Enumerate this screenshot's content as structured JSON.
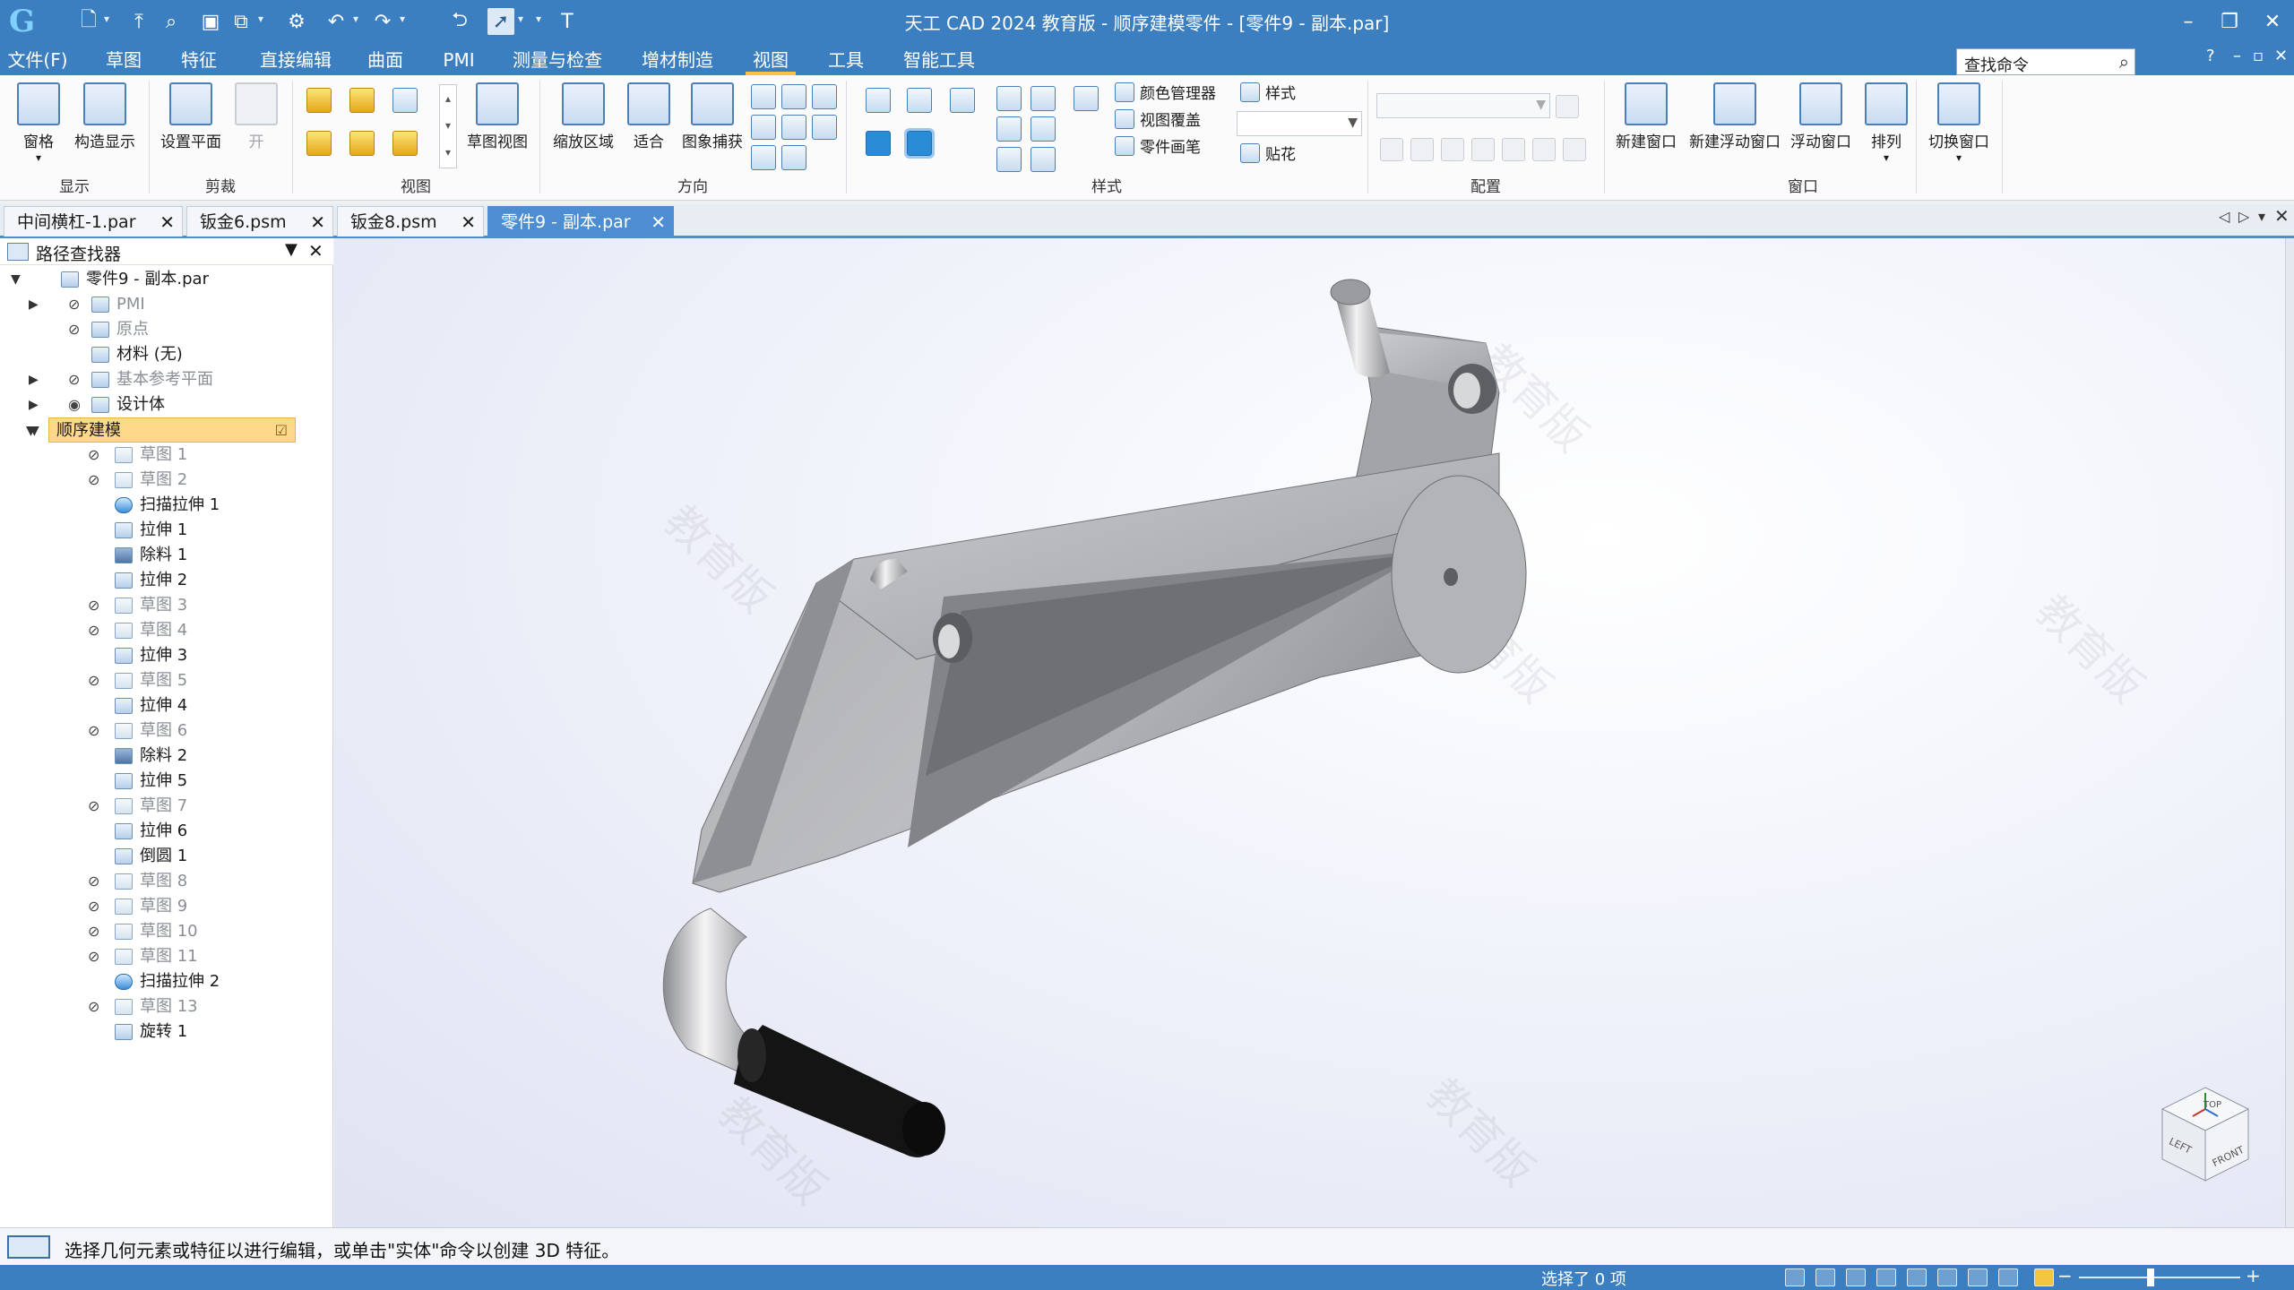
{
  "window": {
    "title": "天工 CAD 2024 教育版 - 顺序建模零件 - [零件9 - 副本.par]",
    "min_glyph": "–",
    "restore_glyph": "❐",
    "close_glyph": "✕"
  },
  "menu": {
    "items": [
      "文件(F)",
      "草图",
      "特征",
      "直接编辑",
      "曲面",
      "PMI",
      "测量与检查",
      "增材制造",
      "视图",
      "工具",
      "智能工具"
    ],
    "active": "视图",
    "search_value": "查找命令",
    "help": "?",
    "right_controls": [
      "–",
      "▫",
      "✕"
    ]
  },
  "ribbon": {
    "groups": {
      "display": "显示",
      "clip": "剪裁",
      "view": "视图",
      "orient": "方向",
      "style": "样式",
      "config": "配置",
      "window": "窗口"
    },
    "buttons": {
      "pane": "窗格",
      "construct_display": "构造显示",
      "set_plane": "设置平面",
      "open": "开",
      "sketch_view": "草图视图",
      "zoom_area": "缩放区域",
      "fit": "适合",
      "image_capture": "图象捕获",
      "color_manager": "颜色管理器",
      "view_overlay": "视图覆盖",
      "part_painter": "零件画笔",
      "style": "样式",
      "decal": "贴花",
      "new_window": "新建窗口",
      "new_float_window": "新建浮动窗口",
      "float_window": "浮动窗口",
      "arrange": "排列",
      "switch_window": "切换窗口"
    }
  },
  "tabs": [
    {
      "label": "中间横杠-1.par",
      "active": false
    },
    {
      "label": "钣金6.psm",
      "active": false
    },
    {
      "label": "钣金8.psm",
      "active": false
    },
    {
      "label": "零件9 - 副本.par",
      "active": true
    }
  ],
  "tab_close": "✕",
  "pathfinder": {
    "title": "路径查找器",
    "items": [
      {
        "label": "零件9 - 副本.par",
        "level": 0,
        "expand": "▼",
        "icon": "part",
        "eye": "",
        "dim": false
      },
      {
        "label": "PMI",
        "level": 1,
        "expand": "▶",
        "icon": "pmi",
        "eye": "⊘",
        "dim": true
      },
      {
        "label": "原点",
        "level": 1,
        "expand": "",
        "icon": "origin",
        "eye": "⊘",
        "dim": true
      },
      {
        "label": "材料 (无)",
        "level": 1,
        "expand": "",
        "icon": "material",
        "eye": "",
        "dim": false
      },
      {
        "label": "基本参考平面",
        "level": 1,
        "expand": "▶",
        "icon": "plane",
        "eye": "⊘",
        "dim": true
      },
      {
        "label": "设计体",
        "level": 1,
        "expand": "▶",
        "icon": "body",
        "eye": "◉",
        "dim": false
      },
      {
        "label": "顺序建模",
        "level": 1,
        "expand": "▼",
        "icon": "",
        "eye": "",
        "dim": false,
        "selected": true
      },
      {
        "label": "草图 1",
        "level": 2,
        "expand": "",
        "icon": "sketch",
        "eye": "⊘",
        "dim": true
      },
      {
        "label": "草图 2",
        "level": 2,
        "expand": "",
        "icon": "sketch",
        "eye": "⊘",
        "dim": true
      },
      {
        "label": "扫描拉伸 1",
        "level": 2,
        "expand": "",
        "icon": "sweep",
        "eye": "",
        "dim": false
      },
      {
        "label": "拉伸 1",
        "level": 2,
        "expand": "",
        "icon": "extrude",
        "eye": "",
        "dim": false
      },
      {
        "label": "除料 1",
        "level": 2,
        "expand": "",
        "icon": "cut",
        "eye": "",
        "dim": false
      },
      {
        "label": "拉伸 2",
        "level": 2,
        "expand": "",
        "icon": "extrude",
        "eye": "",
        "dim": false
      },
      {
        "label": "草图 3",
        "level": 2,
        "expand": "",
        "icon": "sketch",
        "eye": "⊘",
        "dim": true
      },
      {
        "label": "草图 4",
        "level": 2,
        "expand": "",
        "icon": "sketch",
        "eye": "⊘",
        "dim": true
      },
      {
        "label": "拉伸 3",
        "level": 2,
        "expand": "",
        "icon": "extrude",
        "eye": "",
        "dim": false
      },
      {
        "label": "草图 5",
        "level": 2,
        "expand": "",
        "icon": "sketch",
        "eye": "⊘",
        "dim": true
      },
      {
        "label": "拉伸 4",
        "level": 2,
        "expand": "",
        "icon": "extrude",
        "eye": "",
        "dim": false
      },
      {
        "label": "草图 6",
        "level": 2,
        "expand": "",
        "icon": "sketch",
        "eye": "⊘",
        "dim": true
      },
      {
        "label": "除料 2",
        "level": 2,
        "expand": "",
        "icon": "cut",
        "eye": "",
        "dim": false
      },
      {
        "label": "拉伸 5",
        "level": 2,
        "expand": "",
        "icon": "extrude",
        "eye": "",
        "dim": false
      },
      {
        "label": "草图 7",
        "level": 2,
        "expand": "",
        "icon": "sketch",
        "eye": "⊘",
        "dim": true
      },
      {
        "label": "拉伸 6",
        "level": 2,
        "expand": "",
        "icon": "extrude",
        "eye": "",
        "dim": false
      },
      {
        "label": "倒圆 1",
        "level": 2,
        "expand": "",
        "icon": "round",
        "eye": "",
        "dim": false
      },
      {
        "label": "草图 8",
        "level": 2,
        "expand": "",
        "icon": "sketch",
        "eye": "⊘",
        "dim": true
      },
      {
        "label": "草图 9",
        "level": 2,
        "expand": "",
        "icon": "sketch",
        "eye": "⊘",
        "dim": true
      },
      {
        "label": "草图 10",
        "level": 2,
        "expand": "",
        "icon": "sketch",
        "eye": "⊘",
        "dim": true
      },
      {
        "label": "草图 11",
        "level": 2,
        "expand": "",
        "icon": "sketch",
        "eye": "⊘",
        "dim": true
      },
      {
        "label": "扫描拉伸 2",
        "level": 2,
        "expand": "",
        "icon": "sweep",
        "eye": "",
        "dim": false
      },
      {
        "label": "草图 13",
        "level": 2,
        "expand": "",
        "icon": "sketch",
        "eye": "⊘",
        "dim": true
      },
      {
        "label": "旋转 1",
        "level": 2,
        "expand": "",
        "icon": "revolve",
        "eye": "",
        "dim": false
      }
    ]
  },
  "viewport": {
    "watermark": "教育版",
    "viewcube": {
      "top": "TOP",
      "left": "LEFT",
      "front": "FRONT"
    },
    "model_colors": {
      "body": "#a9aaad",
      "highlight": "#d5d6d9",
      "shadow": "#7e7f83",
      "grip": "#141414"
    }
  },
  "prompt": "选择几何元素或特征以进行编辑，或单击\"实体\"命令以创建 3D 特征。",
  "status": {
    "selection_count": "选择了 0 项",
    "zoom_minus": "−",
    "zoom_plus": "+"
  }
}
